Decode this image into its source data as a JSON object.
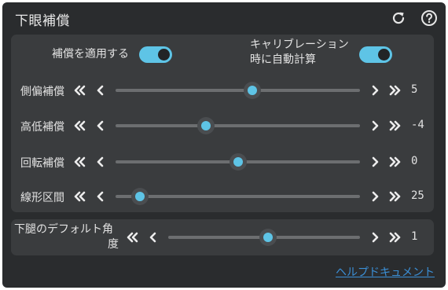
{
  "panel": {
    "title": "下眼補償",
    "refresh_icon": "refresh-icon",
    "help_icon": "help-circle-icon"
  },
  "toggles": {
    "apply": {
      "label": "補償を適用する",
      "on": true
    },
    "during_calibration": {
      "label_line1": "キャリブレーション",
      "label_line2": "時に自動計算",
      "on": true
    }
  },
  "sliders": [
    {
      "label": "側偏補償",
      "value": "5",
      "fraction": 0.56
    },
    {
      "label": "高低補償",
      "value": "-4",
      "fraction": 0.37
    },
    {
      "label": "回転補償",
      "value": "0",
      "fraction": 0.5
    },
    {
      "label": "線形区間",
      "value": "25",
      "fraction": 0.1
    }
  ],
  "angle": {
    "label_line1": "下腿のデフォルト角",
    "label_line2": "度",
    "value": "1",
    "fraction": 0.52
  },
  "help_link": "ヘルプドキュメント",
  "colors": {
    "accent": "#5ec4e6",
    "panel": "#2a2c2e",
    "card": "#3a3c3e",
    "link": "#3b8fd6"
  }
}
